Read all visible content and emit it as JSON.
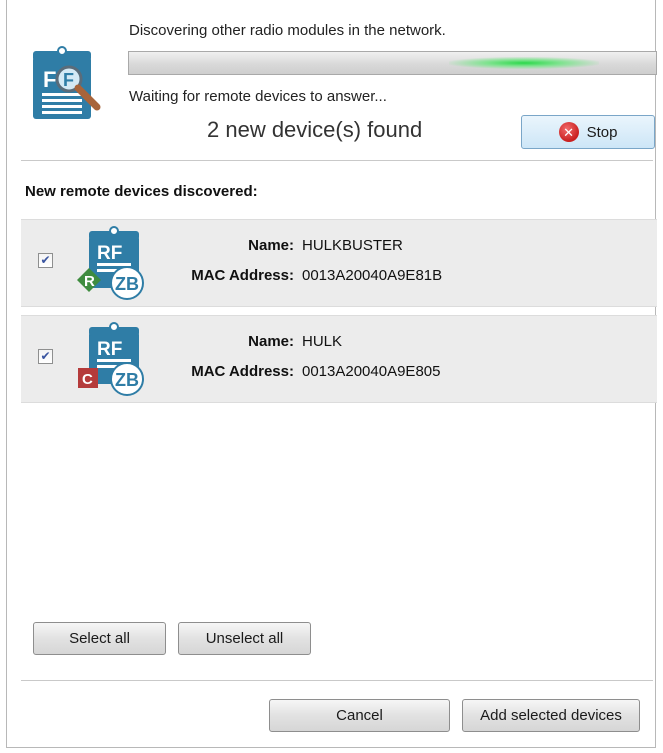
{
  "header": {
    "discovering_text": "Discovering other radio modules in the network.",
    "waiting_text": "Waiting for remote devices to answer...",
    "found_text": "2 new device(s) found",
    "stop_label": "Stop",
    "app_icon_letters": "F"
  },
  "section_title": "New remote devices discovered:",
  "devices": [
    {
      "checked": true,
      "name_label": "Name:",
      "name": "HULKBUSTER",
      "mac_label": "MAC Address:",
      "mac": "0013A20040A9E81B",
      "icon_top": "RF",
      "icon_role": "R",
      "icon_protocol": "ZB"
    },
    {
      "checked": true,
      "name_label": "Name:",
      "name": "HULK",
      "mac_label": "MAC Address:",
      "mac": "0013A20040A9E805",
      "icon_top": "RF",
      "icon_role": "C",
      "icon_protocol": "ZB"
    }
  ],
  "buttons": {
    "select_all": "Select all",
    "unselect_all": "Unselect all",
    "cancel": "Cancel",
    "add_selected": "Add selected devices"
  },
  "colors": {
    "module_blue": "#2f7da6",
    "router_green": "#3f8c3f",
    "coordinator_red": "#b53b3b",
    "stop_red": "#c91f1f",
    "progress_green": "#2bd84a"
  }
}
